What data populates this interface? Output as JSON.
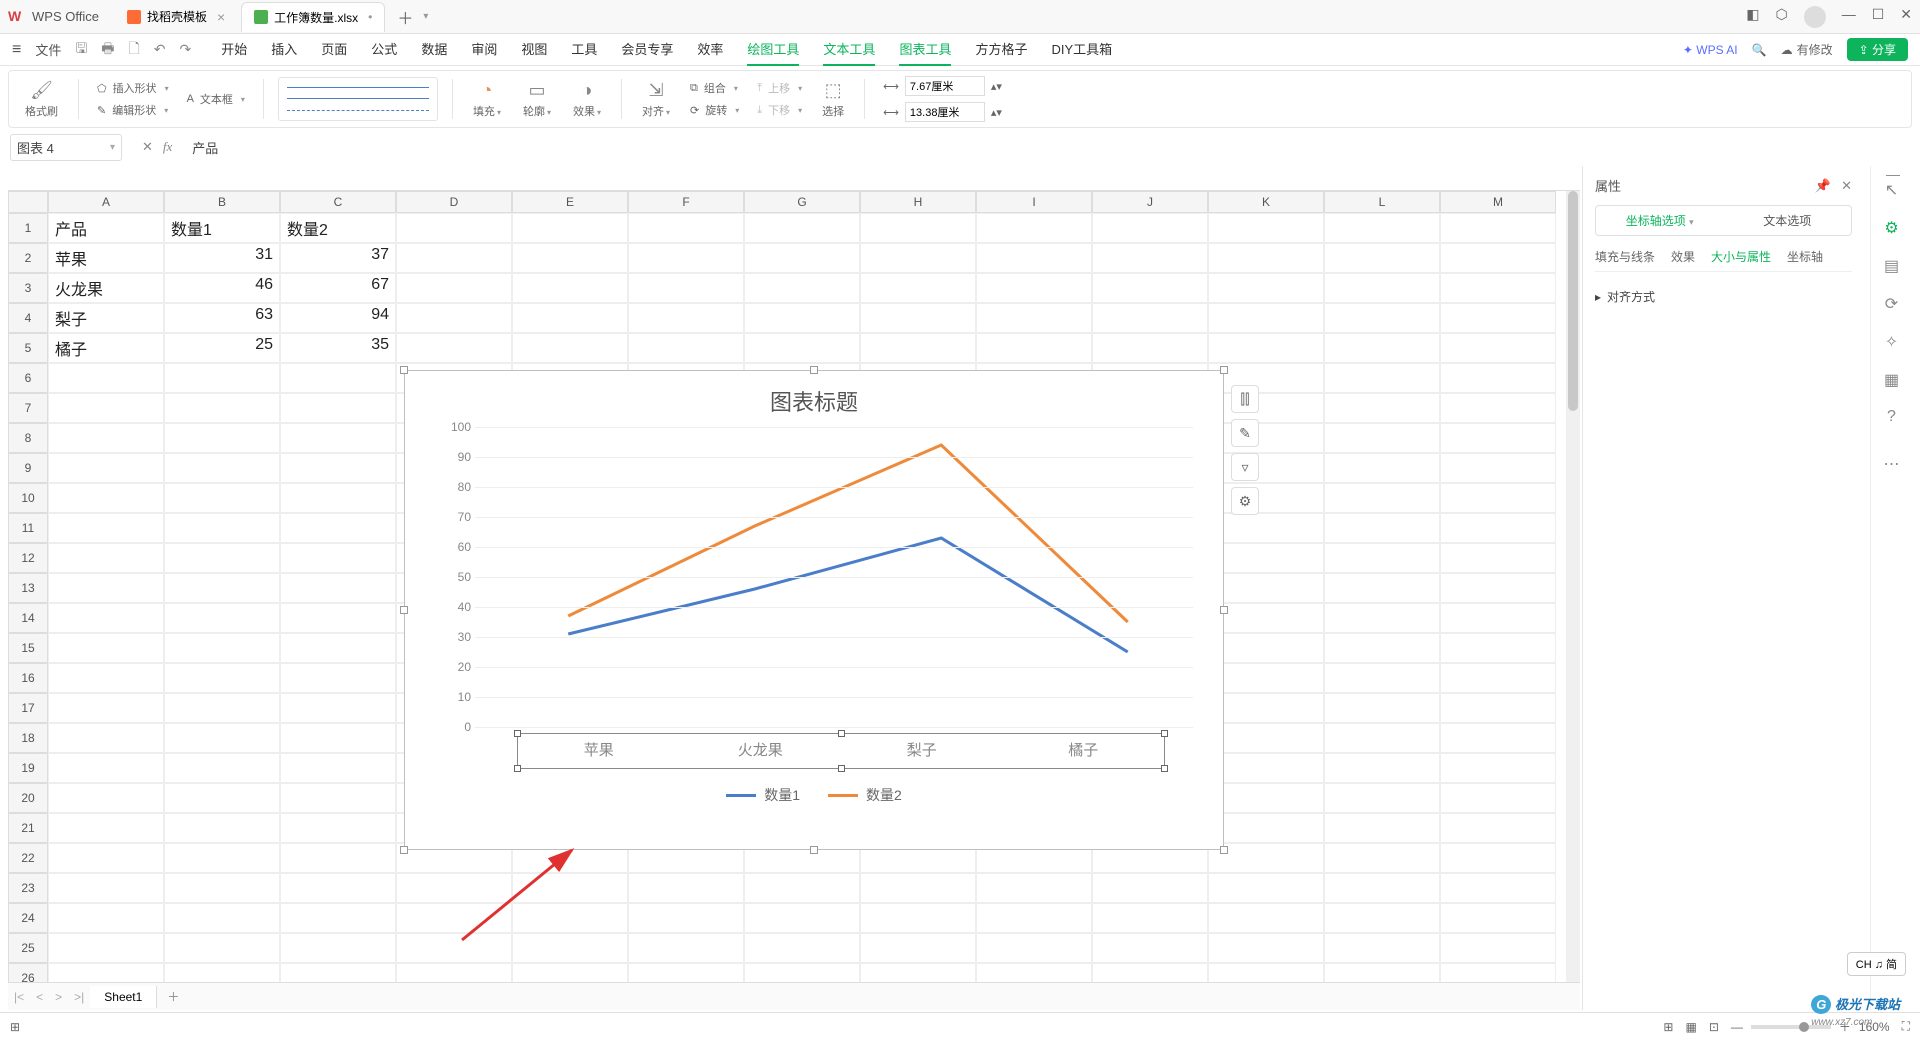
{
  "app": {
    "name": "WPS Office"
  },
  "tabs": [
    {
      "label": "找稻壳模板",
      "type": "doc"
    },
    {
      "label": "工作簿数量.xlsx",
      "type": "sheet",
      "dirty": true,
      "active": true
    }
  ],
  "menubar": {
    "file": "文件",
    "items": [
      "开始",
      "插入",
      "页面",
      "公式",
      "数据",
      "审阅",
      "视图",
      "工具",
      "会员专享",
      "效率",
      "绘图工具",
      "文本工具",
      "图表工具",
      "方方格子",
      "DIY工具箱"
    ],
    "activeGreen": [
      "绘图工具",
      "文本工具",
      "图表工具"
    ],
    "ai": "WPS AI",
    "modified": "有修改",
    "share": "分享"
  },
  "ribbon": {
    "formatBrush": "格式刷",
    "insertShape": "插入形状",
    "editShape": "编辑形状",
    "textBox": "文本框",
    "fill": "填充",
    "outline": "轮廓",
    "effect": "效果",
    "align": "对齐",
    "group": "组合",
    "rotate": "旋转",
    "moveUp": "上移",
    "moveDown": "下移",
    "select": "选择",
    "width": "7.67厘米",
    "height": "13.38厘米"
  },
  "namebox": "图表 4",
  "formula": "产品",
  "columns": [
    "A",
    "B",
    "C",
    "D",
    "E",
    "F",
    "G",
    "H",
    "I",
    "J",
    "K",
    "L",
    "M"
  ],
  "rows": 27,
  "cells": {
    "A1": "产品",
    "B1": "数量1",
    "C1": "数量2",
    "A2": "苹果",
    "B2": "31",
    "C2": "37",
    "A3": "火龙果",
    "B3": "46",
    "C3": "67",
    "A4": "梨子",
    "B4": "63",
    "C4": "94",
    "A5": "橘子",
    "B5": "25",
    "C5": "35"
  },
  "chart_data": {
    "type": "line",
    "title": "图表标题",
    "categories": [
      "苹果",
      "火龙果",
      "梨子",
      "橘子"
    ],
    "series": [
      {
        "name": "数量1",
        "color": "#4a7ec9",
        "values": [
          31,
          46,
          63,
          25
        ]
      },
      {
        "name": "数量2",
        "color": "#ef8a3b",
        "values": [
          37,
          67,
          94,
          35
        ]
      }
    ],
    "ylim": [
      0,
      100
    ],
    "yticks": [
      0,
      10,
      20,
      30,
      40,
      50,
      60,
      70,
      80,
      90,
      100
    ],
    "xlabel": "",
    "ylabel": ""
  },
  "rightPanel": {
    "title": "属性",
    "segment": [
      "坐标轴选项",
      "文本选项"
    ],
    "segmentActive": 0,
    "tabs": [
      "填充与线条",
      "效果",
      "大小与属性",
      "坐标轴"
    ],
    "tabActive": 2,
    "section": "对齐方式"
  },
  "sheetTab": "Sheet1",
  "status": {
    "zoom": "160%",
    "ime": "CH ♫ 简"
  },
  "watermark": {
    "brand": "极光下载站",
    "url": "www.xz7.com"
  }
}
